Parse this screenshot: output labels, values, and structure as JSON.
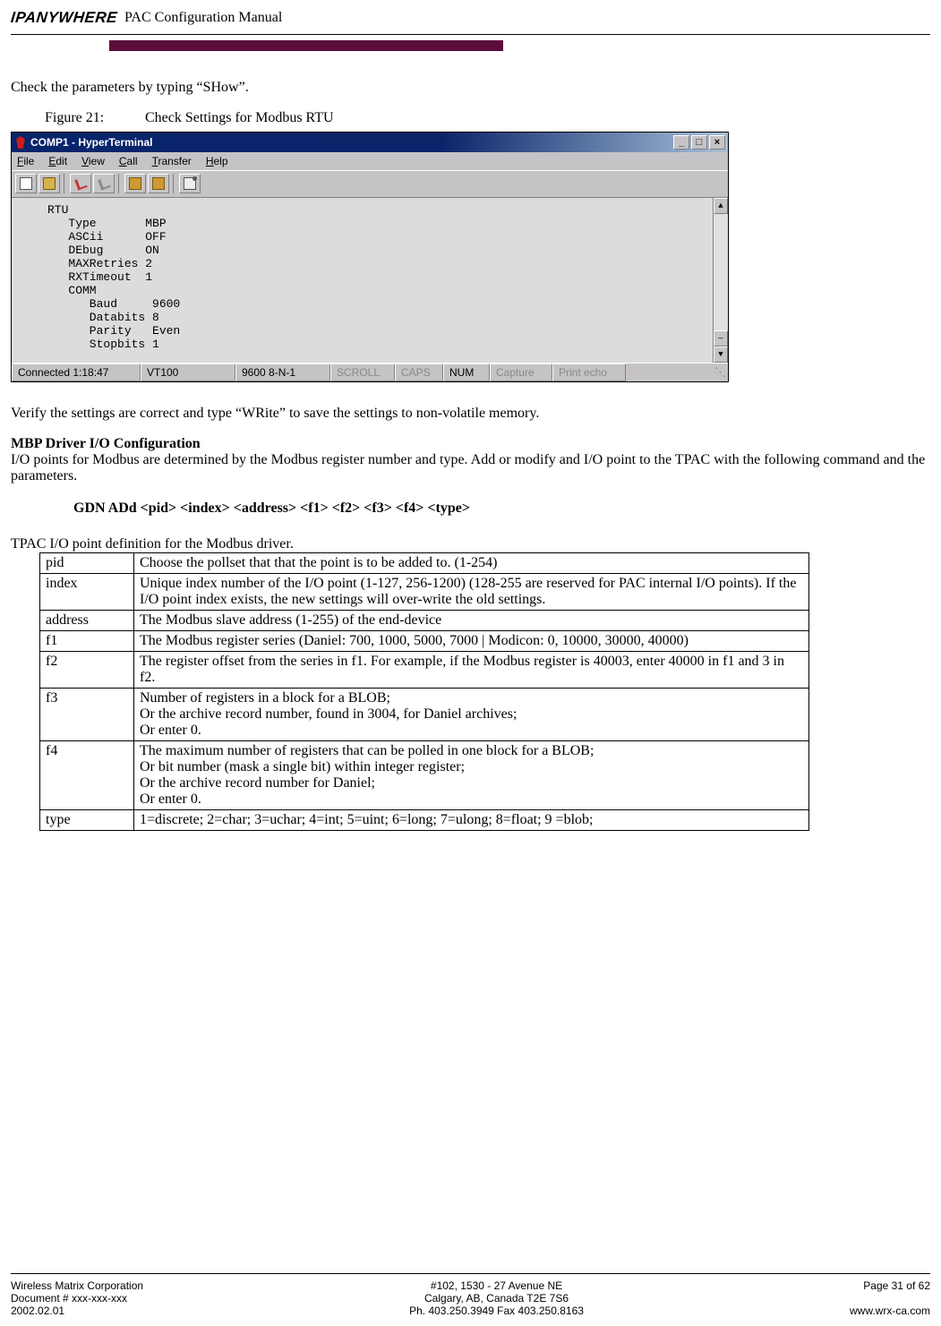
{
  "header": {
    "logo_text": "IPANYWHERE",
    "title": "PAC Configuration Manual"
  },
  "body": {
    "check_params": "Check the parameters by typing “SHow”.",
    "figure_label": "Figure 21:",
    "figure_title": "Check Settings for Modbus RTU",
    "verify": "Verify the settings are correct and type “WRite” to save the settings to non-volatile memory.",
    "mbp_head": "MBP Driver I/O Configuration",
    "mbp_para": "I/O points for Modbus are determined by the Modbus register number and type.  Add or modify and I/O point to the TPAC with the following command and the parameters.",
    "gdn_cmd": "GDN ADd <pid> <index> <address> <f1> <f2> <f3> <f4> <type>",
    "defs_title": "TPAC I/O point definition for the Modbus driver.",
    "table": [
      {
        "param": "pid",
        "desc": "Choose the pollset that that the point is to be added to. (1-254)"
      },
      {
        "param": "index",
        "desc": "Unique index number of the I/O point (1-127, 256-1200) (128-255 are reserved for PAC internal I/O points).  If the I/O point index exists, the new settings will over-write the old settings."
      },
      {
        "param": "address",
        "desc": "The Modbus slave address (1-255) of the end-device"
      },
      {
        "param": "f1",
        "desc": "The Modbus register series (Daniel: 700, 1000, 5000, 7000 | Modicon: 0, 10000, 30000, 40000)"
      },
      {
        "param": "f2",
        "desc": "The register offset from the series in f1. For example, if the Modbus register is 40003, enter 40000 in f1 and 3 in f2."
      },
      {
        "param": "f3",
        "desc": "Number of registers in a block for a BLOB;\nOr the archive record number, found in 3004, for Daniel archives;\nOr enter 0."
      },
      {
        "param": "f4",
        "desc": "The maximum number of registers that can be polled in one block for a BLOB;\nOr bit number (mask a single bit) within integer register;\nOr the archive record number for Daniel;\nOr enter 0."
      },
      {
        "param": "type",
        "desc": "1=discrete; 2=char; 3=uchar; 4=int; 5=uint; 6=long; 7=ulong; 8=float; 9 =blob;"
      }
    ]
  },
  "screenshot": {
    "title": "COMP1 - HyperTerminal",
    "menus": [
      "File",
      "Edit",
      "View",
      "Call",
      "Transfer",
      "Help"
    ],
    "terminal_lines": [
      "RTU",
      "   Type       MBP",
      "   ASCii      OFF",
      "   DEbug      ON",
      "   MAXRetries 2",
      "   RXTimeout  1",
      "   COMM",
      "      Baud     9600",
      "      Databits 8",
      "      Parity   Even",
      "      Stopbits 1"
    ],
    "status": {
      "connected": "Connected 1:18:47",
      "emul": "VT100",
      "baud": "9600 8-N-1",
      "scroll": "SCROLL",
      "caps": "CAPS",
      "num": "NUM",
      "capture": "Capture",
      "echo": "Print echo"
    }
  },
  "footer": {
    "left": "Wireless Matrix Corporation\nDocument # xxx-xxx-xxx\n2002.02.01",
    "center": "#102, 1530 - 27 Avenue NE\nCalgary, AB, Canada  T2E 7S6\nPh. 403.250.3949  Fax 403.250.8163",
    "right": "Page 31 of 62\n\nwww.wrx-ca.com"
  }
}
